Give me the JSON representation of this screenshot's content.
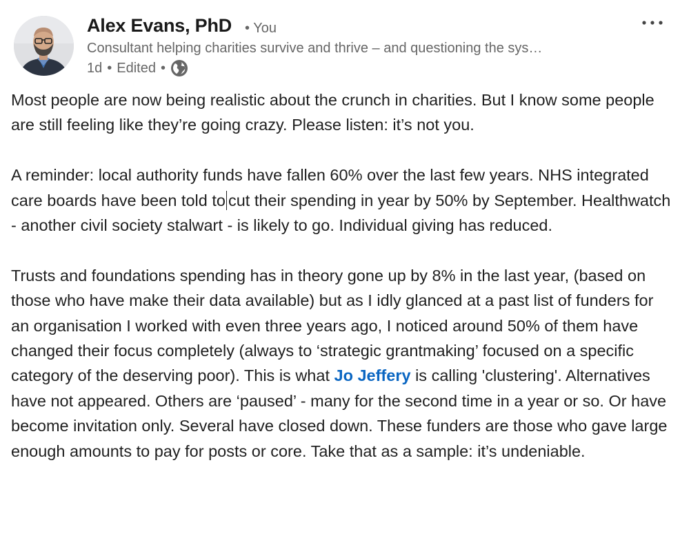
{
  "author": {
    "name": "Alex Evans, PhD",
    "degree": "• You",
    "headline": "Consultant helping charities survive and thrive – and questioning the sys…",
    "time": "1d",
    "edited": "Edited",
    "separator": "•",
    "visibility_icon": "globe-icon",
    "avatar_icon": "profile-photo"
  },
  "menu": {
    "icon": "more-horizontal-icon"
  },
  "post": {
    "p1": "Most people are now being realistic about the crunch in charities. But I know some people are still feeling like they’re going crazy. Please listen: it’s not you.",
    "p2a": "A reminder: local authority funds have fallen 60% over the last few years. NHS integrated care boards have been told to",
    "p2b": "cut their spending in year by 50% by September. Healthwatch - another civil society stalwart - is likely to go. Individual giving has reduced.",
    "p3a": "Trusts and foundations spending has in theory gone up by 8% in the last year, (based on those who have make their data available) but as I idly glanced at a past list of funders for an organisation I worked with even three years ago, I noticed around 50% of them have changed their focus completely (always to ‘strategic grantmaking’ focused on a specific category of the deserving poor). This is what",
    "mention": "Jo Jeffery",
    "p3b": "is calling 'clustering'. Alternatives have not appeared. Others are ‘paused’ - many for the second time in a year or so. Or have become invitation only. Several have closed down. These funders are those who gave large enough amounts to pay for posts or core. Take that as a sample: it’s undeniable."
  },
  "colors": {
    "name": "#191919",
    "secondary": "#666666",
    "body": "#1f1f1f",
    "mention": "#0a66c2",
    "background": "#ffffff"
  }
}
